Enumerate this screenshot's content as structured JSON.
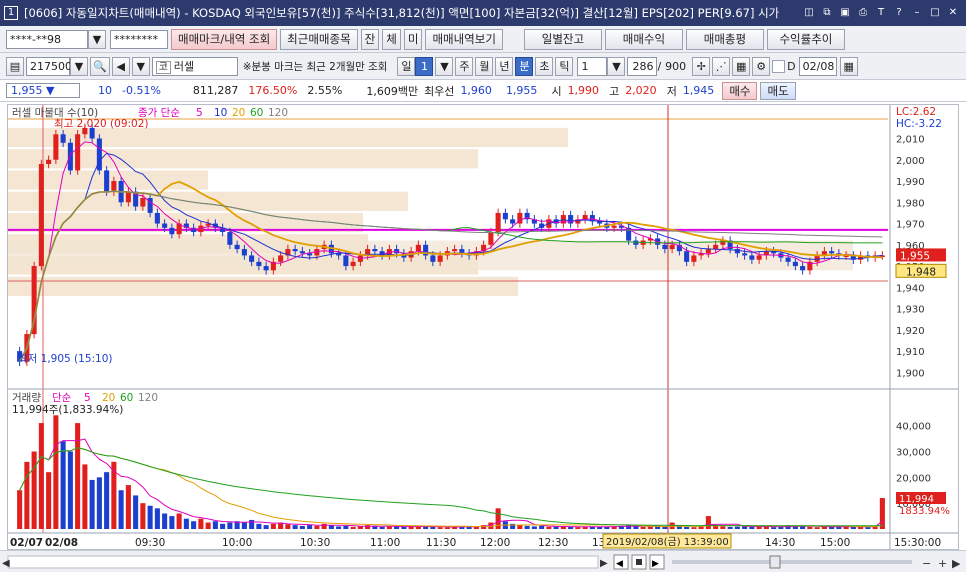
{
  "title": {
    "number": "1",
    "text": "[0606] 자동일지차트(매매내역) - KOSDAQ 외국인보유[57(천)] 주식수[31,812(천)] 액면[100] 자본금[32(억)] 결산[12월] EPS[202] PER[9.67] 시가"
  },
  "toolbar1": {
    "account": "****-**98",
    "password": "********",
    "btn_trade_mark": "매매마크/내역 조회",
    "btn_recent_trades": "최근매매종목",
    "btn_jan": "잔",
    "btn_che": "체",
    "btn_mi": "미",
    "btn_trade_view": "매매내역보기",
    "btn_daily_balance": "일별잔고",
    "btn_trade_profit": "매매수익",
    "btn_trade_review": "매매총평",
    "btn_return_trend": "수익률추이"
  },
  "toolbar2": {
    "code": "217500",
    "stock_name": "러셀",
    "note": "※분봉 마크는 최근 2개월만 조회",
    "period_buttons": [
      "일",
      "주",
      "월",
      "년",
      "분",
      "초",
      "틱"
    ],
    "period_selected": "분",
    "period_value": "1",
    "interval": "1",
    "count": "286",
    "total": "900",
    "d_label": "D",
    "date": "02/08"
  },
  "quote": {
    "price": "1,955 ▼",
    "change": "10",
    "change_rate": "-0.51%",
    "volume": "811,287",
    "volume_rate": "176.50%",
    "turnover": "2.55%",
    "amount": "1,609백만",
    "best_ask_label": "최우선",
    "best_ask": "1,960",
    "best_bid": "1,955",
    "open_label": "시",
    "open": "1,990",
    "high_label": "고",
    "high": "2,020",
    "low_label": "저",
    "low": "1,945",
    "buy_btn": "매수",
    "sell_btn": "매도"
  },
  "price_panel": {
    "legend_name": "러셀 마물대 수(10)",
    "legend_ma": "종가 단순",
    "ma_periods": [
      "5",
      "10",
      "20",
      "60",
      "120"
    ],
    "lc": "LC:2.62",
    "hc": "HC:-3.22",
    "high_label": "최고 2,020 (09:02)",
    "low_label": "최저 1,905 (15:10)",
    "current_price": "1,955",
    "ref_price": "1,948",
    "y_ticks": [
      "2,010",
      "2,000",
      "1,990",
      "1,980",
      "1,970",
      "1,960",
      "1,950",
      "1,940",
      "1,930",
      "1,920",
      "1,910",
      "1,900"
    ]
  },
  "volume_panel": {
    "legend_name": "거래량",
    "legend_ma": "단순",
    "ma_periods": [
      "5",
      "20",
      "60",
      "120"
    ],
    "value_label": "11,994주(1,833.94%)",
    "current_volume": "11,994",
    "current_rate": "1833.94%",
    "y_ticks": [
      "40,000",
      "30,000",
      "20,000",
      "10,000"
    ]
  },
  "x_axis": {
    "labels": [
      "02/07",
      "02/08",
      "09:30",
      "10:00",
      "10:30",
      "11:00",
      "11:30",
      "12:00",
      "12:30",
      "13:00",
      "14:30",
      "15:00",
      "15:30:00"
    ],
    "crosshair_label": "2019/02/08(금) 13:39:00"
  },
  "colors": {
    "up": "#e0201c",
    "down": "#1c3fd0",
    "ma5": "#e000c0",
    "ma10": "#2030d0",
    "ma20": "#e0a000",
    "ma60": "#20a020",
    "ma120": "#808080",
    "volume_profile": "#f5e6d4",
    "magenta_line": "#e000e0"
  },
  "chart_data": {
    "type": "candlestick",
    "title": "",
    "y_range": [
      1895,
      2022
    ],
    "volume_range": [
      0,
      48000
    ],
    "session": "09:00-15:30",
    "high": {
      "time": "09:02",
      "value": 2020
    },
    "low": {
      "time": "15:10",
      "value": 1905
    },
    "close_series": [
      1905,
      1918,
      1950,
      1998,
      2000,
      2012,
      2008,
      1995,
      2012,
      2015,
      2010,
      1995,
      1985,
      1990,
      1980,
      1985,
      1978,
      1982,
      1975,
      1970,
      1968,
      1965,
      1970,
      1968,
      1966,
      1969,
      1970,
      1968,
      1966,
      1960,
      1958,
      1955,
      1952,
      1950,
      1948,
      1952,
      1955,
      1958,
      1957,
      1956,
      1955,
      1958,
      1960,
      1956,
      1955,
      1950,
      1952,
      1955,
      1958,
      1957,
      1955,
      1958,
      1956,
      1954,
      1957,
      1960,
      1955,
      1952,
      1955,
      1957,
      1958,
      1956,
      1955,
      1957,
      1960,
      1966,
      1975,
      1972,
      1970,
      1975,
      1972,
      1970,
      1968,
      1972,
      1970,
      1974,
      1970,
      1972,
      1974,
      1971,
      1970,
      1968,
      1969,
      1968,
      1962,
      1960,
      1962,
      1963,
      1960,
      1958,
      1960,
      1957,
      1952,
      1955,
      1956,
      1958,
      1960,
      1962,
      1958,
      1956,
      1955,
      1953,
      1955,
      1957,
      1956,
      1954,
      1952,
      1950,
      1948,
      1952,
      1955,
      1957,
      1956,
      1955,
      1955,
      1953,
      1955,
      1954,
      1955,
      1955
    ],
    "volume_series": [
      15000,
      26000,
      30000,
      41000,
      22000,
      44000,
      34000,
      30000,
      41000,
      25000,
      19000,
      20000,
      22000,
      26000,
      15000,
      17000,
      13000,
      10000,
      9000,
      8000,
      6000,
      5000,
      6000,
      4000,
      3000,
      4000,
      2500,
      3000,
      2000,
      2500,
      3000,
      2500,
      3500,
      2000,
      1500,
      2000,
      2500,
      1800,
      1500,
      1200,
      1500,
      1200,
      2000,
      1500,
      1000,
      1200,
      800,
      1000,
      1500,
      1200,
      800,
      900,
      1000,
      800,
      1200,
      1000,
      800,
      900,
      700,
      600,
      800,
      1000,
      1200,
      900,
      1500,
      2500,
      8000,
      3000,
      2000,
      1500,
      1200,
      1000,
      1200,
      800,
      900,
      1000,
      800,
      700,
      900,
      1000,
      800,
      900,
      1000,
      1200,
      1500,
      1000,
      800,
      900,
      1200,
      900,
      2500,
      1000,
      800,
      700,
      900,
      5000,
      1500,
      1000,
      800,
      900,
      1200,
      1000,
      800,
      900,
      700,
      800,
      1500,
      1200,
      1000,
      800,
      700,
      900,
      1000,
      800,
      900,
      1000,
      800,
      700,
      900,
      11994
    ]
  }
}
